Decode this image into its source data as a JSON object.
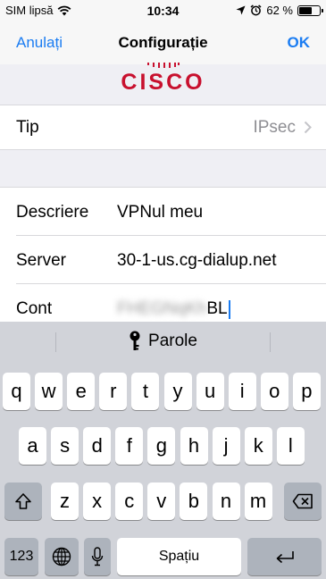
{
  "status_bar": {
    "carrier": "SIM lipsă",
    "time": "10:34",
    "battery_percent": "62 %",
    "battery_level": 0.62
  },
  "nav": {
    "left_label": "Anulați",
    "title": "Configurație",
    "right_label": "OK"
  },
  "logo": {
    "text": "CISCO"
  },
  "rows": {
    "tip": {
      "label": "Tip",
      "value": "IPsec"
    },
    "description": {
      "label": "Descriere",
      "value": "VPNul meu"
    },
    "server": {
      "label": "Server",
      "value": "30-1-us.cg-dialup.net"
    },
    "account": {
      "label": "Cont",
      "value_visible": "BL",
      "value_obscured": "FHEGNqKh"
    }
  },
  "keyboard": {
    "suggestion": "Parole",
    "row1": [
      "q",
      "w",
      "e",
      "r",
      "t",
      "y",
      "u",
      "i",
      "o",
      "p"
    ],
    "row2": [
      "a",
      "s",
      "d",
      "f",
      "g",
      "h",
      "j",
      "k",
      "l"
    ],
    "row3": [
      "z",
      "x",
      "c",
      "v",
      "b",
      "n",
      "m"
    ],
    "numbers_key": "123",
    "space_key": "Spațiu"
  },
  "colors": {
    "accent": "#1a7cf2",
    "cisco_red": "#c8102e"
  }
}
